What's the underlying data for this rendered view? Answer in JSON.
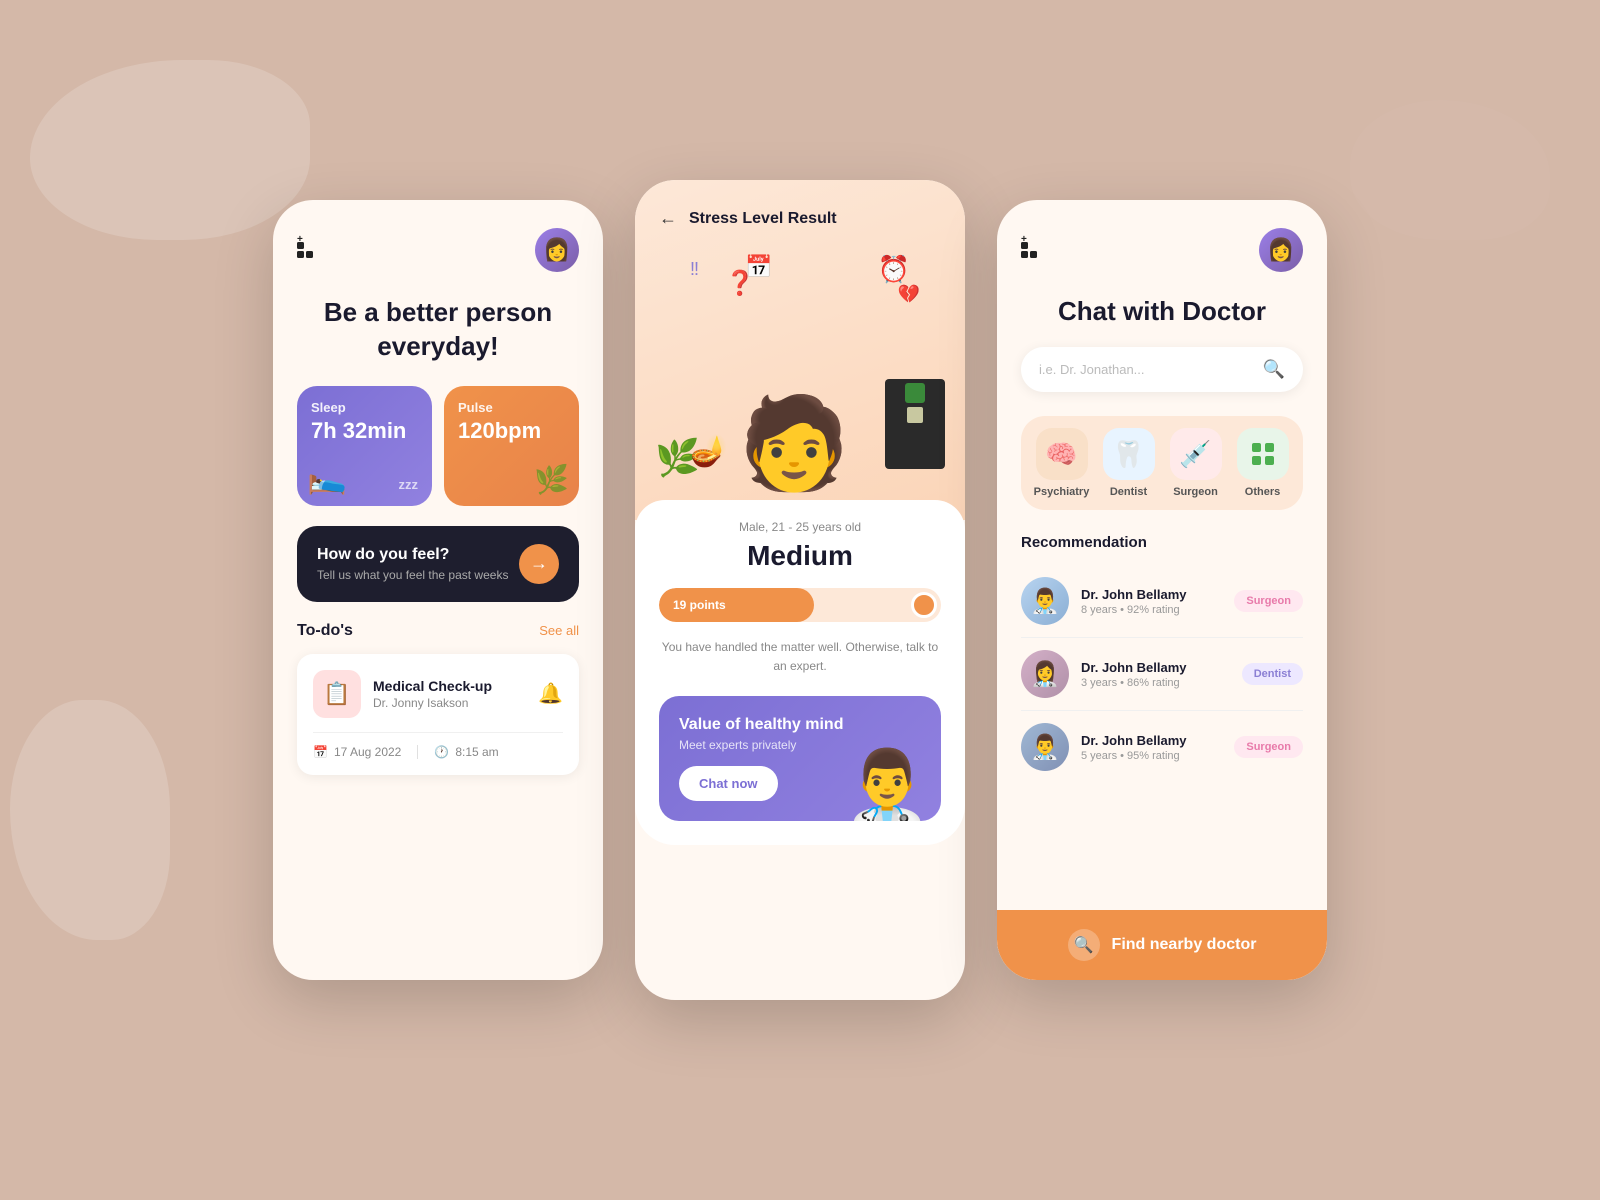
{
  "background": {
    "color": "#d4b8a8"
  },
  "phone1": {
    "title": "Be a better person everyday!",
    "header": {
      "avatar": "👩"
    },
    "stats": {
      "sleep": {
        "label": "Sleep",
        "value": "7h 32min",
        "extra": "zzz"
      },
      "pulse": {
        "label": "Pulse",
        "value": "120bpm"
      }
    },
    "feel_card": {
      "title": "How do you feel?",
      "subtitle": "Tell us what you feel the past weeks"
    },
    "todos": {
      "title": "To-do's",
      "see_all": "See all",
      "item": {
        "title": "Medical Check-up",
        "doctor": "Dr. Jonny Isakson",
        "date": "17 Aug 2022",
        "time": "8:15 am"
      }
    }
  },
  "phone2": {
    "header": {
      "back": "←",
      "title": "Stress Level Result"
    },
    "stress": {
      "meta": "Male, 21 - 25 years old",
      "level": "Medium",
      "points": "19 points",
      "progress_pct": 55,
      "description": "You have handled the matter well. Otherwise, talk to an expert."
    },
    "value_card": {
      "title": "Value of healthy mind",
      "subtitle": "Meet experts privately",
      "cta": "Chat now"
    }
  },
  "phone3": {
    "header": {
      "avatar": "👩"
    },
    "title": "Chat with Doctor",
    "search": {
      "placeholder": "i.e. Dr. Jonathan..."
    },
    "categories": [
      {
        "label": "Psychiatry",
        "icon": "🧠",
        "color": "psych"
      },
      {
        "label": "Dentist",
        "icon": "🦷",
        "color": "dentist"
      },
      {
        "label": "Surgeon",
        "icon": "💉",
        "color": "surgeon"
      },
      {
        "label": "Others",
        "icon": "⊞",
        "color": "others"
      }
    ],
    "recommendation_title": "Recommendation",
    "doctors": [
      {
        "name": "Dr. John Bellamy",
        "meta": "8 years • 92% rating",
        "badge": "Surgeon",
        "badge_type": "surgeon",
        "avatar": "👨‍⚕️"
      },
      {
        "name": "Dr. John Bellamy",
        "meta": "3 years • 86% rating",
        "badge": "Dentist",
        "badge_type": "dentist",
        "avatar": "👩‍⚕️"
      },
      {
        "name": "Dr. John Bellamy",
        "meta": "5 years • 95% rating",
        "badge": "Surgeon",
        "badge_type": "surgeon",
        "avatar": "👨‍⚕️"
      }
    ],
    "footer": {
      "cta": "Find nearby doctor"
    }
  }
}
